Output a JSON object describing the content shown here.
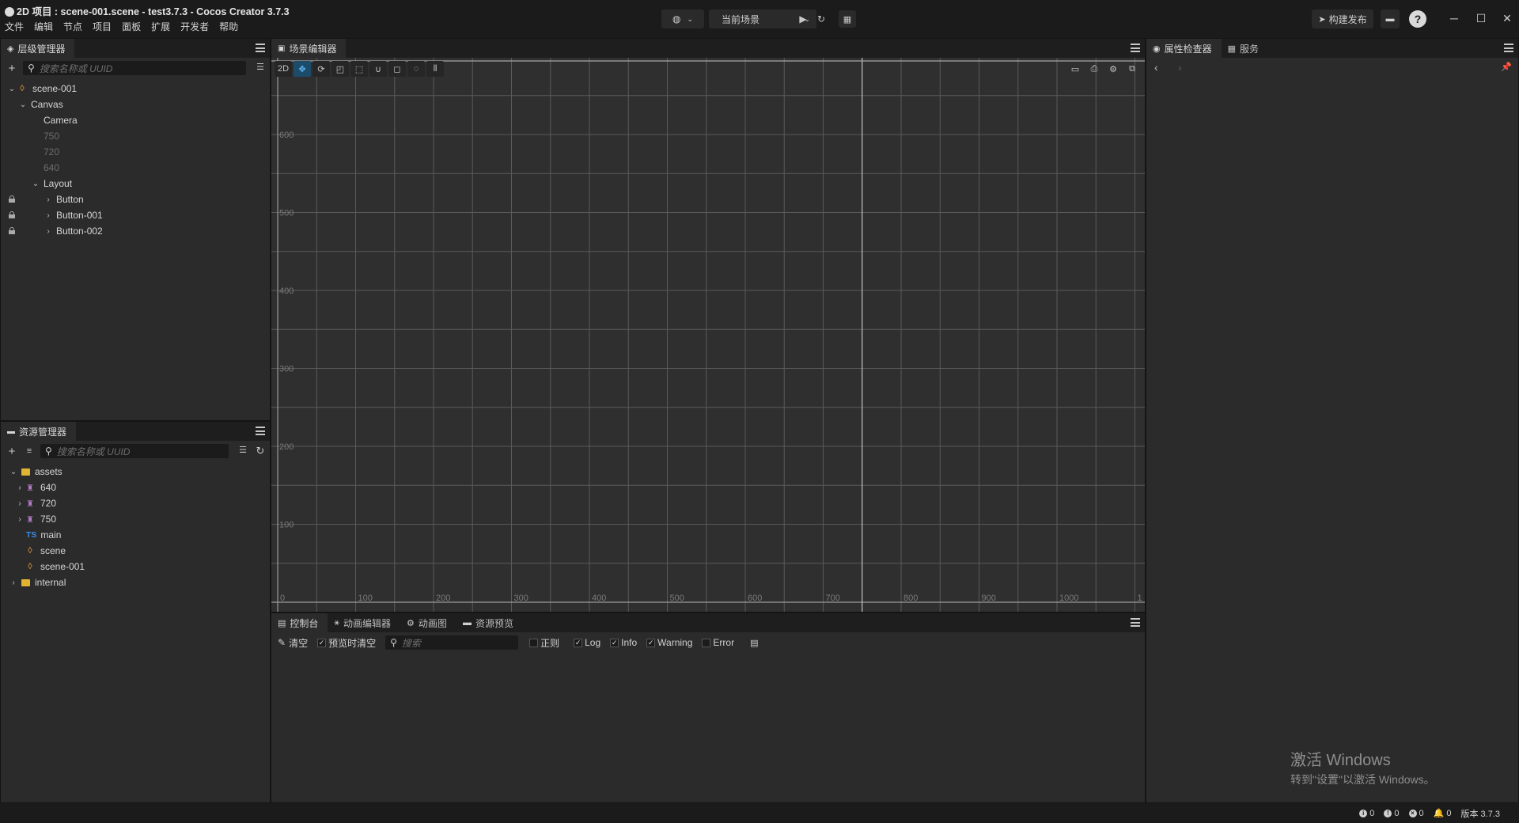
{
  "window": {
    "title": "2D 项目 : scene-001.scene - test3.7.3 - Cocos Creator 3.7.3",
    "menu": [
      "文件",
      "编辑",
      "节点",
      "项目",
      "面板",
      "扩展",
      "开发者",
      "帮助"
    ]
  },
  "toolbar": {
    "scene_select": "当前场景",
    "build_label": "构建发布",
    "help_label": "?"
  },
  "hierarchy": {
    "title": "层级管理器",
    "search_placeholder": "搜索名称或 UUID",
    "nodes": {
      "scene": "scene-001",
      "canvas": "Canvas",
      "camera": "Camera",
      "n750": "750",
      "n720": "720",
      "n640": "640",
      "layout": "Layout",
      "button": "Button",
      "button1": "Button-001",
      "button2": "Button-002"
    }
  },
  "assets": {
    "title": "资源管理器",
    "search_placeholder": "搜索名称或 UUID",
    "items": {
      "assets": "assets",
      "a640": "640",
      "a720": "720",
      "a750": "750",
      "main": "main",
      "ts": "TS",
      "scene": "scene",
      "scene001": "scene-001",
      "internal": "internal"
    }
  },
  "scene_editor": {
    "title": "场景编辑器",
    "mode": "2D",
    "grid": {
      "x_labels": [
        "0",
        "100",
        "200",
        "300",
        "400",
        "500",
        "600",
        "700",
        "800",
        "900",
        "1000",
        "1"
      ],
      "y_labels": [
        "600",
        "500",
        "400",
        "300",
        "200",
        "100"
      ]
    }
  },
  "console": {
    "tabs": [
      "控制台",
      "动画编辑器",
      "动画图",
      "资源预览"
    ],
    "clear": "清空",
    "clear_on_preview": "预览时清空",
    "search_placeholder": "搜索",
    "regex": "正则",
    "log": "Log",
    "info": "Info",
    "warning": "Warning",
    "error": "Error"
  },
  "inspector": {
    "tabs": [
      "属性检查器",
      "服务"
    ]
  },
  "statusbar": {
    "info_count": "0",
    "warn_count": "0",
    "error_count": "0",
    "notify_count": "0",
    "version": "版本 3.7.3"
  },
  "watermark": {
    "title": "激活 Windows",
    "subtitle": "转到\"设置\"以激活 Windows。"
  }
}
